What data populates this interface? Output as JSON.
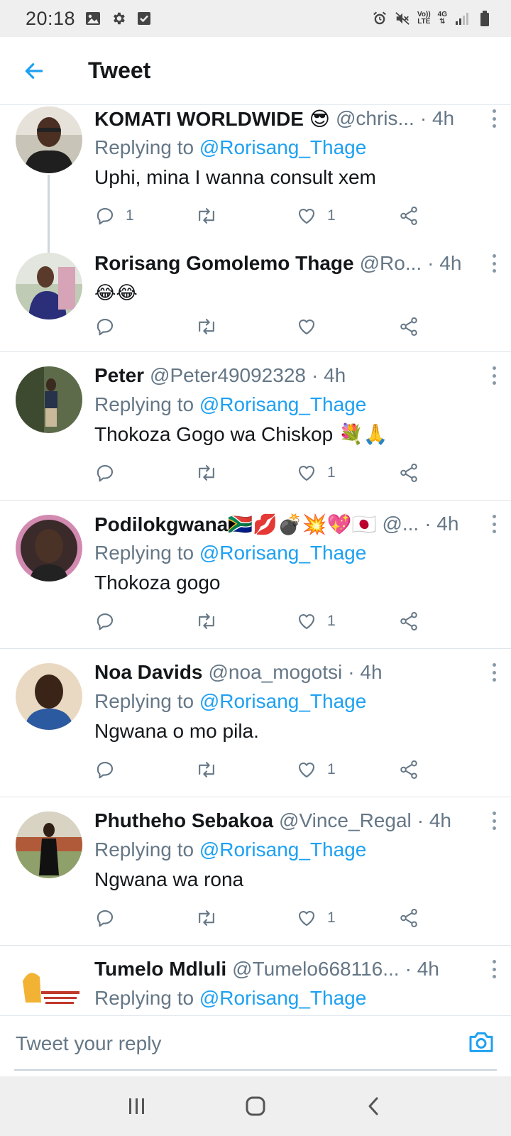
{
  "status_bar": {
    "time": "20:18",
    "left_icons": [
      "image-icon",
      "gear-icon",
      "checkbox-icon"
    ],
    "right_icons": [
      "alarm-icon",
      "mute-icon",
      "volte-icon",
      "4g-icon",
      "signal-icon",
      "battery-icon"
    ],
    "volte_label_1": "Vo))",
    "volte_label_2": "LTE",
    "network_label": "4G"
  },
  "header": {
    "title": "Tweet"
  },
  "colors": {
    "link": "#1da1f2",
    "secondary": "#657786",
    "icon": "#657786",
    "accent": "#1da1f2"
  },
  "tweets": [
    {
      "name": "KOMATI WORLDWIDE 😎",
      "handle": "@chris...",
      "time": "· 4h",
      "replying_prefix": "Replying to ",
      "replying_to": "@Rorisang_Thage",
      "text": "Uphi, mina I wanna consult xem",
      "reply_count": "1",
      "retweet_count": "",
      "like_count": "1"
    },
    {
      "name": "Rorisang Gomolemo Thage",
      "handle": "@Ro...",
      "time": "· 4h",
      "text": "😂😂",
      "reply_count": "",
      "retweet_count": "",
      "like_count": ""
    },
    {
      "name": "Peter",
      "handle": "@Peter49092328",
      "time": "· 4h",
      "replying_prefix": "Replying to ",
      "replying_to": "@Rorisang_Thage",
      "text": "Thokoza Gogo wa Chiskop 💐🙏",
      "reply_count": "",
      "retweet_count": "",
      "like_count": "1"
    },
    {
      "name": "Podilokgwana🇿🇦💋💣💥💖🇯🇵",
      "handle": "@...",
      "time": "· 4h",
      "replying_prefix": "Replying to ",
      "replying_to": "@Rorisang_Thage",
      "text": "Thokoza gogo",
      "reply_count": "",
      "retweet_count": "",
      "like_count": "1"
    },
    {
      "name": "Noa Davids",
      "handle": "@noa_mogotsi",
      "time": "· 4h",
      "replying_prefix": "Replying to ",
      "replying_to": "@Rorisang_Thage",
      "text": "Ngwana o mo pila.",
      "reply_count": "",
      "retweet_count": "",
      "like_count": "1"
    },
    {
      "name": "Phutheho Sebakoa",
      "handle": "@Vince_Regal",
      "time": "· 4h",
      "replying_prefix": "Replying to ",
      "replying_to": "@Rorisang_Thage",
      "text": "Ngwana wa rona",
      "reply_count": "",
      "retweet_count": "",
      "like_count": "1"
    },
    {
      "name": "Tumelo Mdluli",
      "handle": "@Tumelo668116...",
      "time": "· 4h",
      "replying_prefix": "Replying to ",
      "replying_to": "@Rorisang_Thage"
    }
  ],
  "composer": {
    "placeholder": "Tweet your reply"
  },
  "nav_bar": {
    "buttons": [
      "recents-icon",
      "home-icon",
      "back-icon"
    ]
  }
}
